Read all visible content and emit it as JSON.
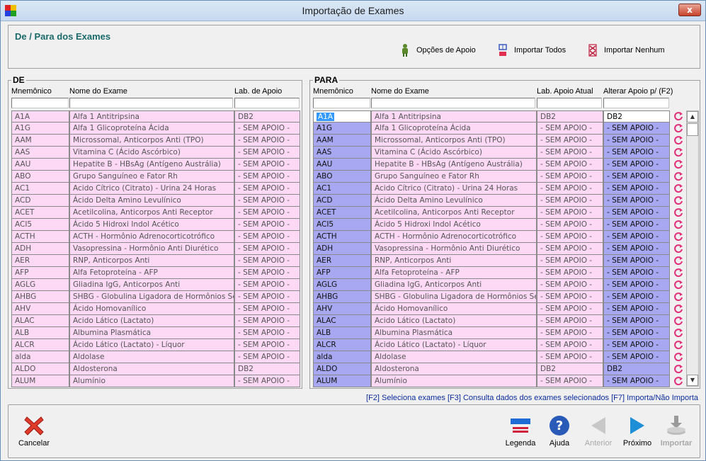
{
  "window": {
    "title": "Importação de Exames",
    "close_label": "x"
  },
  "header": {
    "title": "De / Para dos Exames",
    "buttons": [
      {
        "label": "Opções de Apoio",
        "icon": "person-icon"
      },
      {
        "label": "Importar Todos",
        "icon": "import-all-icon"
      },
      {
        "label": "Importar Nenhum",
        "icon": "import-none-icon"
      }
    ]
  },
  "de": {
    "title": "DE",
    "columns": [
      "Mnemônico",
      "Nome do Exame",
      "Lab. de Apoio"
    ],
    "rows": [
      [
        "A1A",
        "Alfa 1 Antitripsina",
        "DB2"
      ],
      [
        "A1G",
        "Alfa 1 Glicoproteína Ácida",
        "- SEM APOIO -"
      ],
      [
        "AAM",
        "Microssomal, Anticorpos Anti (TPO)",
        "- SEM APOIO -"
      ],
      [
        "AAS",
        "Vitamina C (Ácido Ascórbico)",
        "- SEM APOIO -"
      ],
      [
        "AAU",
        "Hepatite B - HBsAg (Antígeno Austrália)",
        "- SEM APOIO -"
      ],
      [
        "ABO",
        "Grupo Sanguíneo e Fator Rh",
        "- SEM APOIO -"
      ],
      [
        "AC1",
        "Acido Cítrico (Citrato) - Urina 24 Horas",
        "- SEM APOIO -"
      ],
      [
        "ACD",
        "Ácido Delta Amino Levulínico",
        "- SEM APOIO -"
      ],
      [
        "ACET",
        "Acetilcolina, Anticorpos Anti Receptor",
        "- SEM APOIO -"
      ],
      [
        "ACI5",
        "Ácido 5 Hidroxi Indol Acético",
        "- SEM APOIO -"
      ],
      [
        "ACTH",
        "ACTH - Hormônio Adrenocorticotrófico",
        "- SEM APOIO -"
      ],
      [
        "ADH",
        "Vasopressina - Hormônio Anti Diurético",
        "- SEM APOIO -"
      ],
      [
        "AER",
        "RNP, Anticorpos Anti",
        "- SEM APOIO -"
      ],
      [
        "AFP",
        "Alfa Fetoproteína - AFP",
        "- SEM APOIO -"
      ],
      [
        "AGLG",
        "Gliadina IgG, Anticorpos Anti",
        "- SEM APOIO -"
      ],
      [
        "AHBG",
        "SHBG - Globulina Ligadora de Hormônios Se",
        "- SEM APOIO -"
      ],
      [
        "AHV",
        "Ácido Homovanílico",
        "- SEM APOIO -"
      ],
      [
        "ALAC",
        "Acido Lático (Lactato)",
        "- SEM APOIO -"
      ],
      [
        "ALB",
        "Albumina Plasmática",
        "- SEM APOIO -"
      ],
      [
        "ALCR",
        "Ácido Lático (Lactato) - Líquor",
        "- SEM APOIO -"
      ],
      [
        "alda",
        "Aldolase",
        "- SEM APOIO -"
      ],
      [
        "ALDO",
        "Aldosterona",
        "DB2"
      ],
      [
        "ALUM",
        "Alumínio",
        "- SEM APOIO -"
      ]
    ]
  },
  "para": {
    "title": "PARA",
    "columns": [
      "Mnemônico",
      "Nome do Exame",
      "Lab. Apoio Atual",
      "Alterar Apoio p/ (F2)"
    ],
    "rows": [
      [
        "A1A",
        "Alfa 1 Antitripsina",
        "DB2",
        "DB2"
      ],
      [
        "A1G",
        "Alfa 1 Glicoproteína Ácida",
        "- SEM APOIO -",
        "- SEM APOIO -"
      ],
      [
        "AAM",
        "Microssomal, Anticorpos Anti (TPO)",
        "- SEM APOIO -",
        "- SEM APOIO -"
      ],
      [
        "AAS",
        "Vitamina C (Ácido Ascórbico)",
        "- SEM APOIO -",
        "- SEM APOIO -"
      ],
      [
        "AAU",
        "Hepatite B - HBsAg (Antígeno Austrália)",
        "- SEM APOIO -",
        "- SEM APOIO -"
      ],
      [
        "ABO",
        "Grupo Sanguíneo e Fator Rh",
        "- SEM APOIO -",
        "- SEM APOIO -"
      ],
      [
        "AC1",
        "Acido Cítrico (Citrato) - Urina 24 Horas",
        "- SEM APOIO -",
        "- SEM APOIO -"
      ],
      [
        "ACD",
        "Ácido Delta Amino Levulínico",
        "- SEM APOIO -",
        "- SEM APOIO -"
      ],
      [
        "ACET",
        "Acetilcolina, Anticorpos Anti Receptor",
        "- SEM APOIO -",
        "- SEM APOIO -"
      ],
      [
        "ACI5",
        "Ácido 5 Hidroxi Indol Acético",
        "- SEM APOIO -",
        "- SEM APOIO -"
      ],
      [
        "ACTH",
        "ACTH - Hormônio Adrenocorticotrófico",
        "- SEM APOIO -",
        "- SEM APOIO -"
      ],
      [
        "ADH",
        "Vasopressina - Hormônio Anti Diurético",
        "- SEM APOIO -",
        "- SEM APOIO -"
      ],
      [
        "AER",
        "RNP, Anticorpos Anti",
        "- SEM APOIO -",
        "- SEM APOIO -"
      ],
      [
        "AFP",
        "Alfa Fetoproteína - AFP",
        "- SEM APOIO -",
        "- SEM APOIO -"
      ],
      [
        "AGLG",
        "Gliadina IgG, Anticorpos Anti",
        "- SEM APOIO -",
        "- SEM APOIO -"
      ],
      [
        "AHBG",
        "SHBG - Globulina Ligadora de Hormônios Se:",
        "- SEM APOIO -",
        "- SEM APOIO -"
      ],
      [
        "AHV",
        "Ácido Homovanílico",
        "- SEM APOIO -",
        "- SEM APOIO -"
      ],
      [
        "ALAC",
        "Acido Lático (Lactato)",
        "- SEM APOIO -",
        "- SEM APOIO -"
      ],
      [
        "ALB",
        "Albumina Plasmática",
        "- SEM APOIO -",
        "- SEM APOIO -"
      ],
      [
        "ALCR",
        "Ácido Lático (Lactato) - Líquor",
        "- SEM APOIO -",
        "- SEM APOIO -"
      ],
      [
        "alda",
        "Aldolase",
        "- SEM APOIO -",
        "- SEM APOIO -"
      ],
      [
        "ALDO",
        "Aldosterona",
        "DB2",
        "DB2"
      ],
      [
        "ALUM",
        "Alumínio",
        "- SEM APOIO -",
        "- SEM APOIO -"
      ]
    ]
  },
  "hint": "[F2] Seleciona exames [F3] Consulta dados dos exames selecionados [F7] Importa/Não Importa",
  "footer": {
    "cancel": "Cancelar",
    "legend": "Legenda",
    "help": "Ajuda",
    "prev": "Anterior",
    "next": "Próximo",
    "import": "Importar"
  },
  "colors": {
    "pink": "#fdd9f6",
    "blue": "#a7a7f2",
    "accent": "#1b6a6a",
    "hint": "#0a2c9c"
  }
}
